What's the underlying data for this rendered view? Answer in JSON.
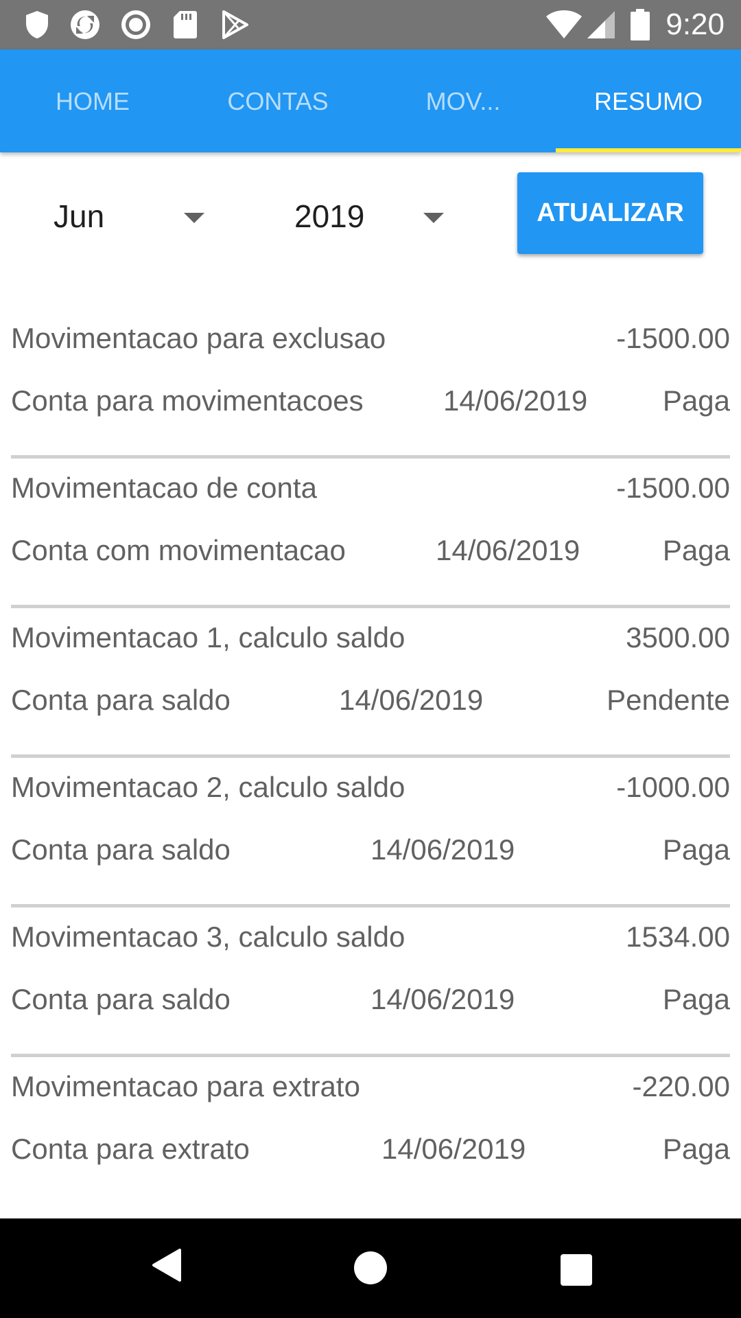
{
  "status_bar": {
    "time": "9:20",
    "icons_left": [
      "shield-icon",
      "sync-icon",
      "radio-icon",
      "sd-card-icon",
      "play-store-icon"
    ],
    "icons_right": [
      "wifi-icon",
      "signal-icon",
      "battery-icon"
    ]
  },
  "tabs": [
    {
      "label": "HOME",
      "active": false
    },
    {
      "label": "CONTAS",
      "active": false
    },
    {
      "label": "MOV...",
      "active": false
    },
    {
      "label": "RESUMO",
      "active": true
    }
  ],
  "filter": {
    "month": "Jun",
    "year": "2019",
    "refresh_label": "ATUALIZAR"
  },
  "transactions": [
    {
      "description": "Movimentacao para exclusao",
      "amount": "-1500.00",
      "account": "Conta para movimentacoes",
      "date": "14/06/2019",
      "status": "Paga"
    },
    {
      "description": "Movimentacao de conta",
      "amount": "-1500.00",
      "account": "Conta com movimentacao",
      "date": "14/06/2019",
      "status": "Paga"
    },
    {
      "description": "Movimentacao 1, calculo saldo",
      "amount": "3500.00",
      "account": "Conta para saldo",
      "date": "14/06/2019",
      "status": "Pendente"
    },
    {
      "description": "Movimentacao 2, calculo saldo",
      "amount": "-1000.00",
      "account": "Conta para saldo",
      "date": "14/06/2019",
      "status": "Paga"
    },
    {
      "description": "Movimentacao 3, calculo saldo",
      "amount": "1534.00",
      "account": "Conta para saldo",
      "date": "14/06/2019",
      "status": "Paga"
    },
    {
      "description": "Movimentacao para extrato",
      "amount": "-220.00",
      "account": "Conta para extrato",
      "date": "14/06/2019",
      "status": "Paga"
    }
  ],
  "nav_bar": {
    "icons": [
      "back-icon",
      "home-icon",
      "recent-apps-icon"
    ]
  },
  "colors": {
    "primary": "#2196F3",
    "tab_indicator": "#FFEB3B",
    "status_bar": "#757575",
    "text_secondary": "#616161",
    "divider": "#d0d0d0"
  }
}
